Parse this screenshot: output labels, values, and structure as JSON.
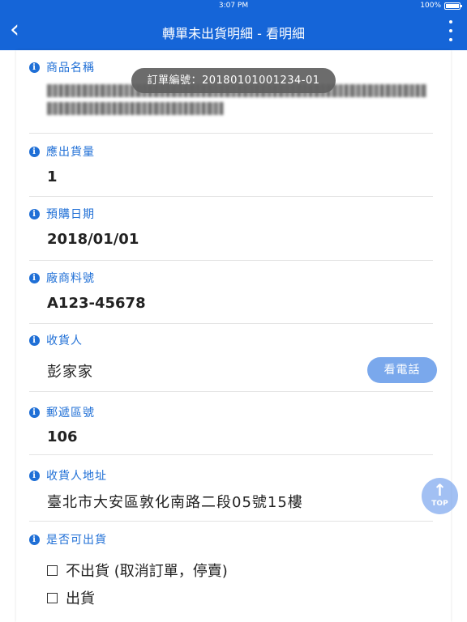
{
  "status_bar": {
    "time": "3:07 PM",
    "battery": "100%"
  },
  "nav": {
    "back_icon": "‹",
    "title": "轉單未出貨明細 - 看明細",
    "more_icon": "vertical-ellipsis"
  },
  "toast": {
    "text": "訂單編號：20180101001234-01"
  },
  "fields": {
    "product_name": {
      "label": "商品名稱"
    },
    "quantity": {
      "label": "應出貨量",
      "value": "1"
    },
    "order_date": {
      "label": "預購日期",
      "value": "2018/01/01"
    },
    "vendor_code": {
      "label": "廠商料號",
      "value": "A123-45678"
    },
    "recipient": {
      "label": "收貨人",
      "value": "彭家家",
      "phone_button": "看電話"
    },
    "postal_code": {
      "label": "郵遞區號",
      "value": "106"
    },
    "address": {
      "label": "收貨人地址",
      "value": "臺北市大安區敦化南路二段05號15樓"
    },
    "shippable": {
      "label": "是否可出貨",
      "options": [
        "不出貨 (取消訂單，停賣)",
        "出貨"
      ]
    }
  },
  "top_button": {
    "arrow": "↑",
    "label": "TOP"
  },
  "colors": {
    "primary": "#1565d8",
    "accent": "#1f6fd6",
    "button": "#7aa8ec"
  }
}
